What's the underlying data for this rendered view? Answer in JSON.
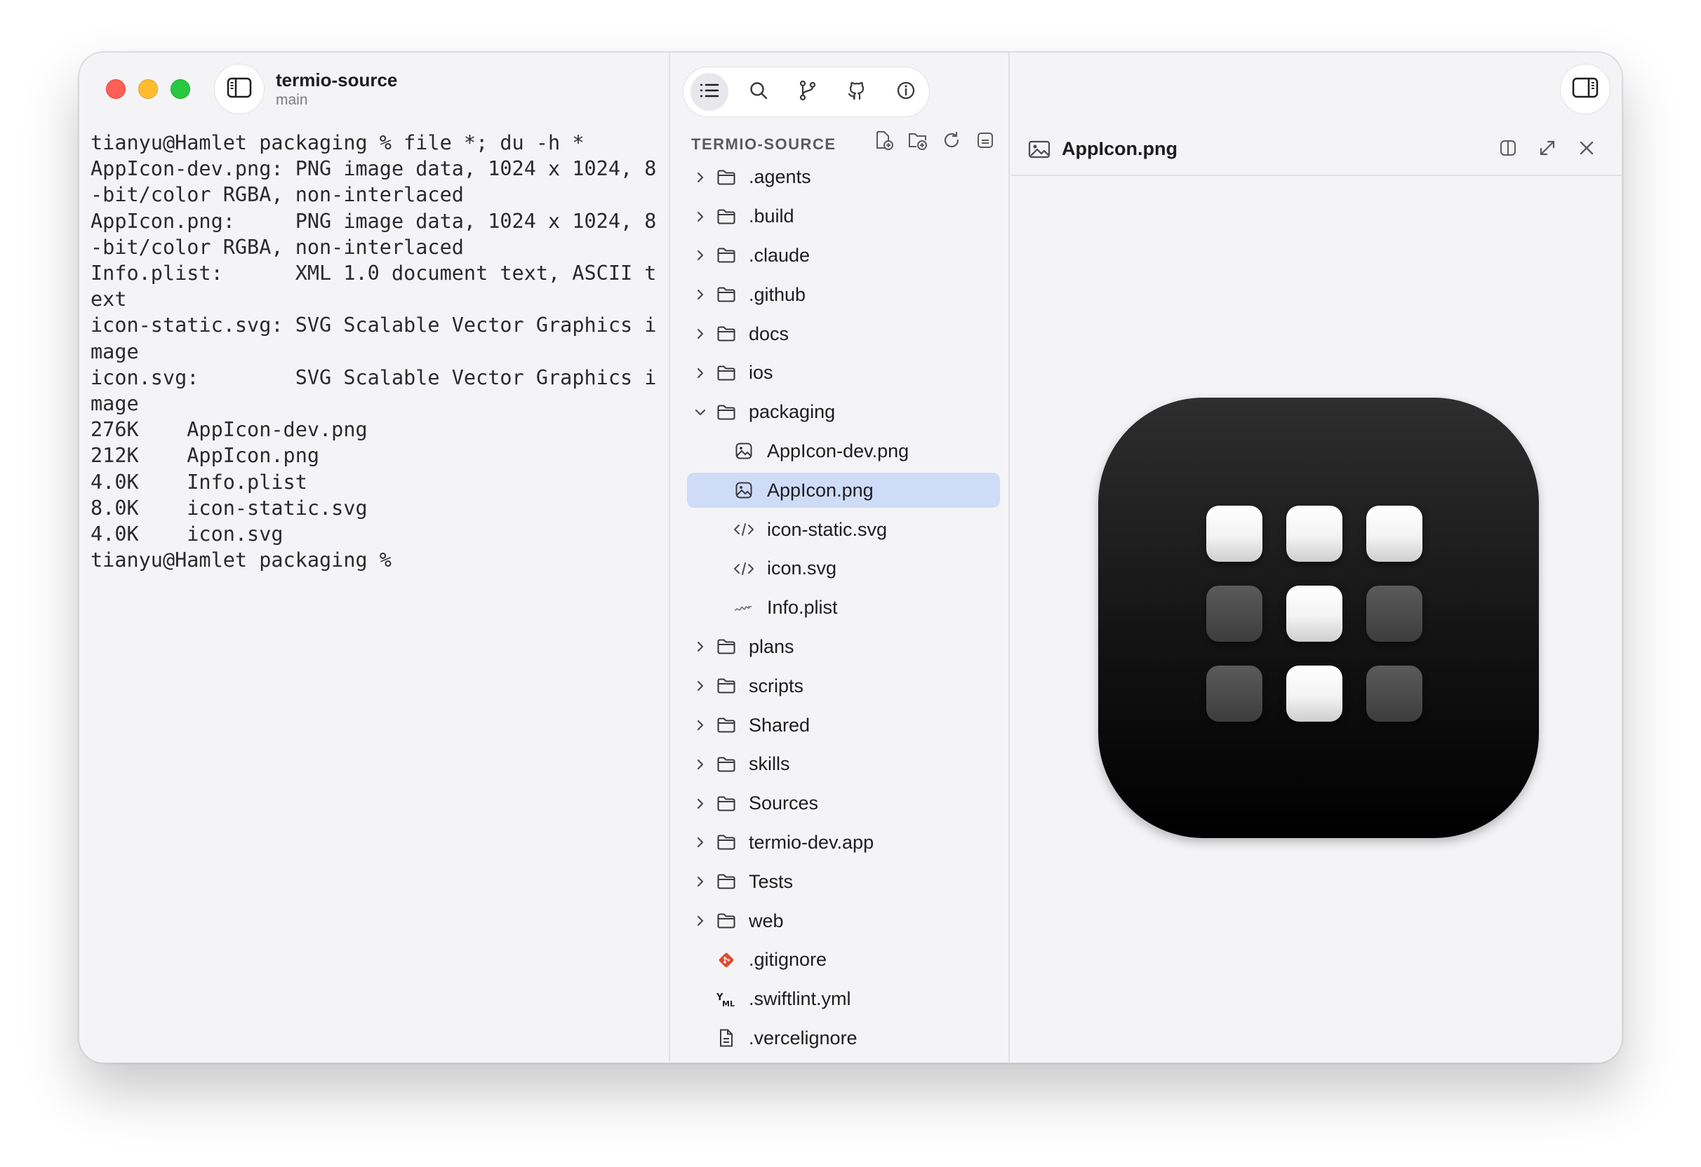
{
  "window": {
    "title": "termio-source",
    "subtitle": "main"
  },
  "terminal": {
    "lines": [
      "tianyu@Hamlet packaging % file *; du -h *",
      "AppIcon-dev.png: PNG image data, 1024 x 1024, 8",
      "-bit/color RGBA, non-interlaced",
      "AppIcon.png:     PNG image data, 1024 x 1024, 8",
      "-bit/color RGBA, non-interlaced",
      "Info.plist:      XML 1.0 document text, ASCII t",
      "ext",
      "icon-static.svg: SVG Scalable Vector Graphics i",
      "mage",
      "icon.svg:        SVG Scalable Vector Graphics i",
      "mage",
      "276K    AppIcon-dev.png",
      "212K    AppIcon.png",
      "4.0K    Info.plist",
      "8.0K    icon-static.svg",
      "4.0K    icon.svg",
      "tianyu@Hamlet packaging %"
    ]
  },
  "toolbar": {
    "buttons": [
      "list-icon",
      "search-icon",
      "source-control-icon",
      "github-icon",
      "info-icon"
    ]
  },
  "explorer": {
    "header": "TERMIO-SOURCE",
    "actions": [
      "new-file-icon",
      "new-folder-icon",
      "refresh-icon",
      "collapse-all-icon"
    ],
    "items": [
      {
        "name": ".agents",
        "kind": "folder",
        "level": 0,
        "expanded": false
      },
      {
        "name": ".build",
        "kind": "folder",
        "level": 0,
        "expanded": false
      },
      {
        "name": ".claude",
        "kind": "folder",
        "level": 0,
        "expanded": false
      },
      {
        "name": ".github",
        "kind": "folder",
        "level": 0,
        "expanded": false
      },
      {
        "name": "docs",
        "kind": "folder",
        "level": 0,
        "expanded": false
      },
      {
        "name": "ios",
        "kind": "folder",
        "level": 0,
        "expanded": false
      },
      {
        "name": "packaging",
        "kind": "folder",
        "level": 0,
        "expanded": true
      },
      {
        "name": "AppIcon-dev.png",
        "kind": "image",
        "level": 1
      },
      {
        "name": "AppIcon.png",
        "kind": "image",
        "level": 1,
        "selected": true
      },
      {
        "name": "icon-static.svg",
        "kind": "code",
        "level": 1
      },
      {
        "name": "icon.svg",
        "kind": "code",
        "level": 1
      },
      {
        "name": "Info.plist",
        "kind": "plist",
        "level": 1
      },
      {
        "name": "plans",
        "kind": "folder",
        "level": 0,
        "expanded": false
      },
      {
        "name": "scripts",
        "kind": "folder",
        "level": 0,
        "expanded": false
      },
      {
        "name": "Shared",
        "kind": "folder",
        "level": 0,
        "expanded": false
      },
      {
        "name": "skills",
        "kind": "folder",
        "level": 0,
        "expanded": false
      },
      {
        "name": "Sources",
        "kind": "folder",
        "level": 0,
        "expanded": false
      },
      {
        "name": "termio-dev.app",
        "kind": "folder",
        "level": 0,
        "expanded": false
      },
      {
        "name": "Tests",
        "kind": "folder",
        "level": 0,
        "expanded": false
      },
      {
        "name": "web",
        "kind": "folder",
        "level": 0,
        "expanded": false
      },
      {
        "name": ".gitignore",
        "kind": "git",
        "level": 0
      },
      {
        "name": ".swiftlint.yml",
        "kind": "yaml",
        "level": 0
      },
      {
        "name": ".vercelignore",
        "kind": "file",
        "level": 0
      }
    ]
  },
  "preview": {
    "title": "AppIcon.png",
    "tile_grid": [
      [
        "on",
        "on",
        "on"
      ],
      [
        "off",
        "on",
        "off"
      ],
      [
        "off",
        "on",
        "off"
      ]
    ]
  },
  "colors": {
    "selection": "#cfdcf7",
    "traffic_red": "#ff5f57",
    "traffic_yellow": "#febc2e",
    "traffic_green": "#28c840",
    "git_icon": "#e24b2f"
  }
}
